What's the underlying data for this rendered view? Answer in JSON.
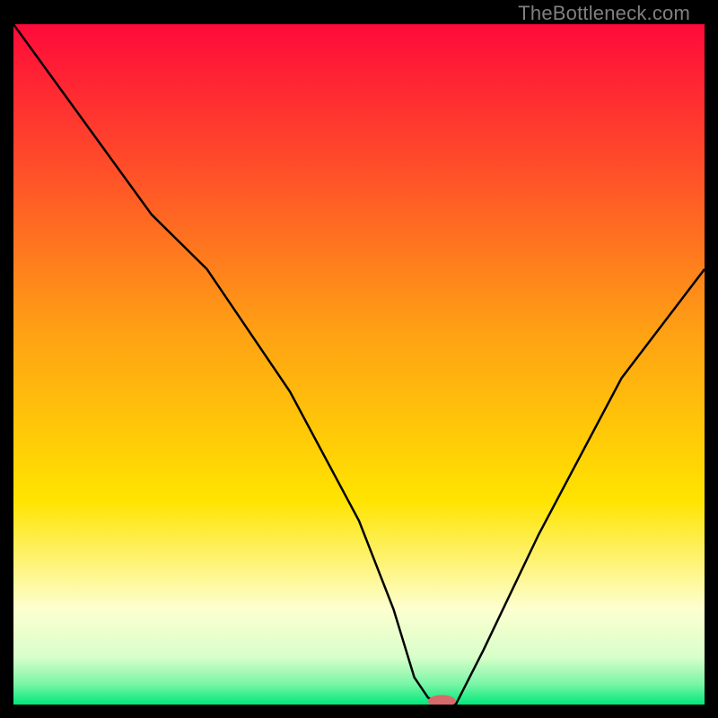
{
  "watermark": "TheBottleneck.com",
  "chart_data": {
    "type": "line",
    "title": "",
    "xlabel": "",
    "ylabel": "",
    "xlim": [
      0,
      100
    ],
    "ylim": [
      0,
      100
    ],
    "background_gradient": {
      "top_color": "#ff0a3a",
      "mid_color": "#ffe400",
      "low_color": "#fdffd0",
      "bottom_color": "#00e87b"
    },
    "series": [
      {
        "name": "bottleneck-curve",
        "x": [
          0,
          10,
          20,
          28,
          40,
          50,
          55,
          58,
          60,
          62,
          64,
          68,
          76,
          88,
          100
        ],
        "y": [
          100,
          86,
          72,
          64,
          46,
          27,
          14,
          4,
          1,
          0,
          0,
          8,
          25,
          48,
          64
        ]
      }
    ],
    "marker": {
      "name": "optimal-point",
      "x": 62,
      "y": 0.5,
      "color": "#d76a6a",
      "rx": 2.0,
      "ry": 0.9
    }
  }
}
